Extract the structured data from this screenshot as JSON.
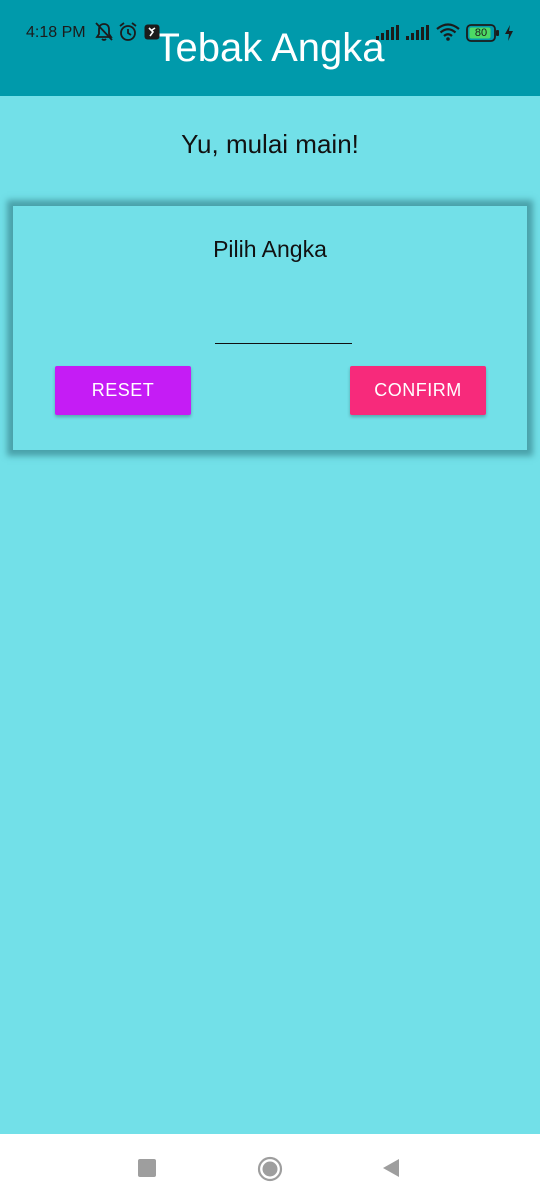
{
  "status_bar": {
    "time": "4:18 PM",
    "battery_level": "80",
    "icons": [
      "notifications-off-icon",
      "alarm-icon",
      "app-notification-icon",
      "signal-icon",
      "signal-icon",
      "wifi-icon",
      "battery-icon",
      "charging-icon"
    ]
  },
  "app_bar": {
    "title": "Tebak Angka"
  },
  "main": {
    "subtitle": "Yu, mulai main!",
    "card": {
      "title": "Pilih Angka",
      "input_value": "",
      "reset_label": "RESET",
      "confirm_label": "CONFIRM"
    }
  },
  "nav_bar": {
    "buttons": [
      "recents-icon",
      "home-icon",
      "back-icon"
    ]
  },
  "colors": {
    "app_bar": "#009AAB",
    "background": "#72E0E8",
    "reset_button": "#C51CF5",
    "confirm_button": "#F72A7B"
  }
}
